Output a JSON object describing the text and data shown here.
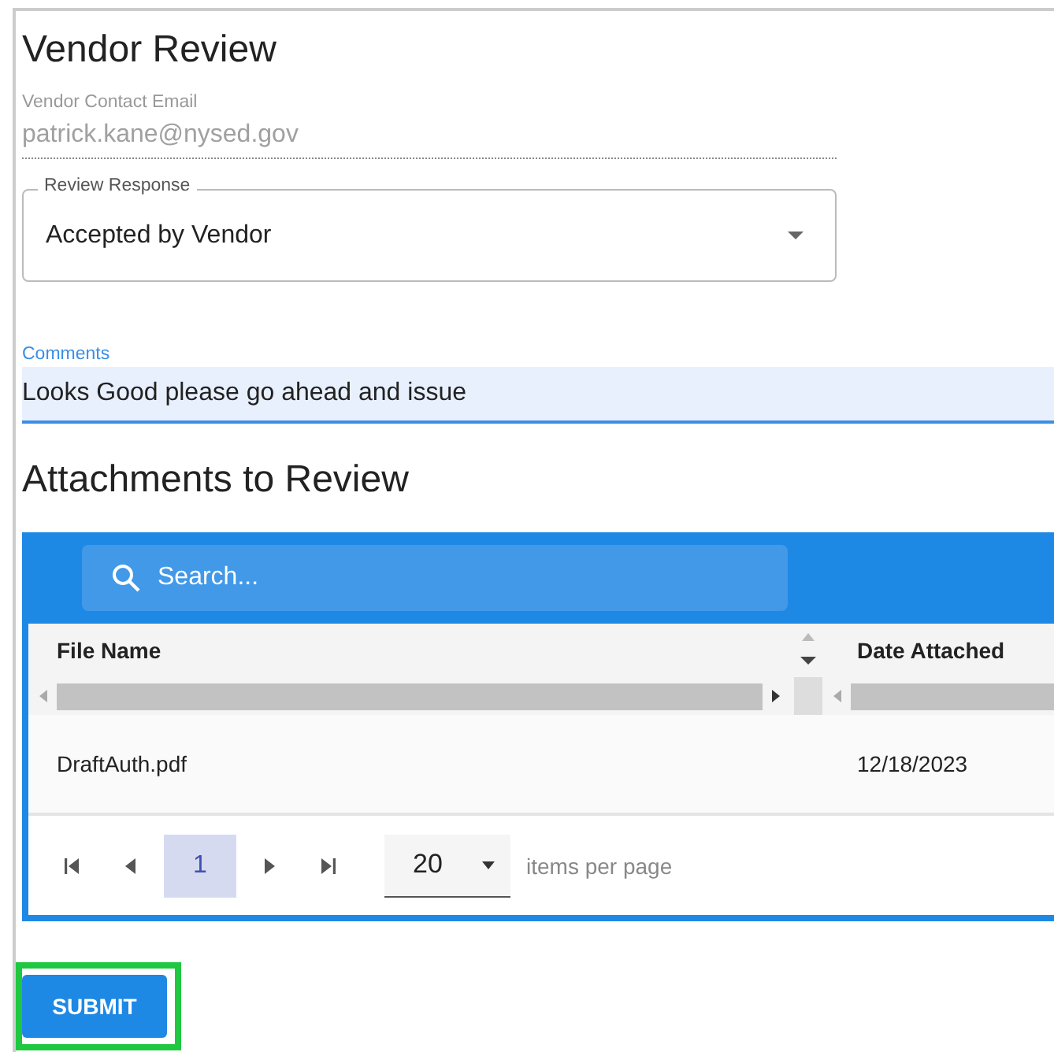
{
  "title": "Vendor Review",
  "email": {
    "label": "Vendor Contact Email",
    "value": "patrick.kane@nysed.gov",
    "disabled": true
  },
  "review_response": {
    "label": "Review Response",
    "value": "Accepted by Vendor"
  },
  "comments": {
    "label": "Comments",
    "value": "Looks Good please go ahead and issue",
    "focused": true
  },
  "attachments": {
    "title": "Attachments to Review",
    "search": {
      "placeholder": "Search..."
    },
    "columns": [
      "File Name",
      "Date Attached"
    ],
    "rows": [
      {
        "cells": [
          "DraftAuth.pdf",
          "12/18/2023"
        ]
      }
    ],
    "pager": {
      "pages": [
        {
          "label": "1",
          "selected": true
        }
      ],
      "page_size": "20",
      "page_size_label": "items per page"
    }
  },
  "submit": {
    "label": "SUBMIT",
    "highlighted": true
  }
}
